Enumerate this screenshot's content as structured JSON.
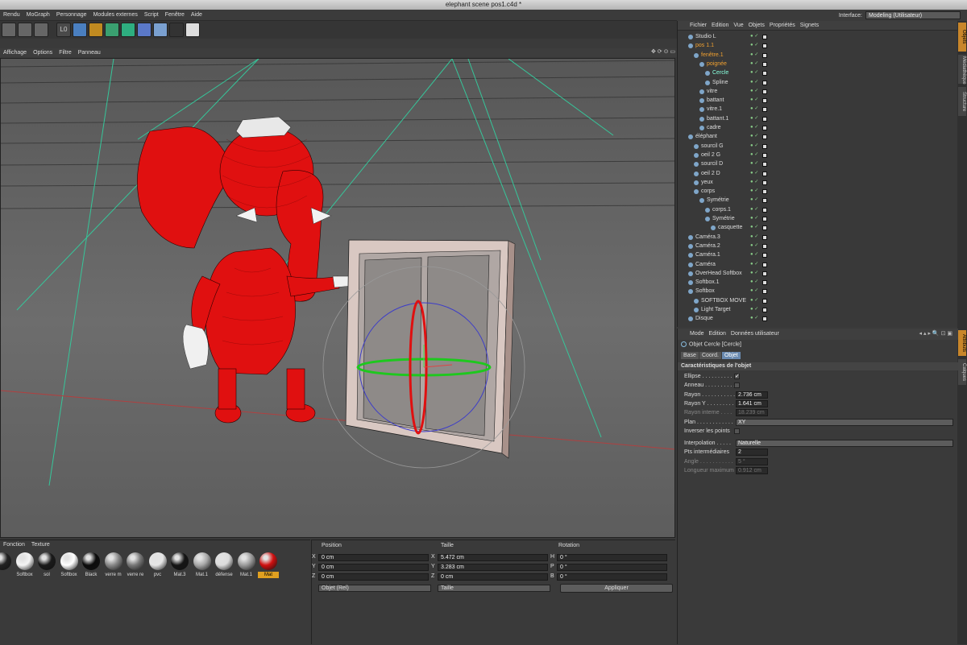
{
  "window": {
    "title": "elephant scene pos1.c4d *"
  },
  "menu": [
    "Rendu",
    "MoGraph",
    "Personnage",
    "Modules externes",
    "Script",
    "Fenêtre",
    "Aide"
  ],
  "interface": {
    "label": "Interface:",
    "value": "Modeling (Utilisateur)"
  },
  "viewport_menu": [
    "Affichage",
    "Options",
    "Filtre",
    "Panneau"
  ],
  "viewport_icons": "✥ ⟳ ⊙ ▭",
  "object_menu": [
    "Fichier",
    "Edition",
    "Vue",
    "Objets",
    "Propriétés",
    "Signets"
  ],
  "objects": [
    {
      "name": "Studio L",
      "indent": 1
    },
    {
      "name": "pos 1.1",
      "indent": 1,
      "hl": true
    },
    {
      "name": "fenêtre.1",
      "indent": 2,
      "hl": true
    },
    {
      "name": "poignée",
      "indent": 3,
      "hl": true
    },
    {
      "name": "Cercle",
      "indent": 4,
      "cyan": true
    },
    {
      "name": "Spline",
      "indent": 4
    },
    {
      "name": "vitre",
      "indent": 3
    },
    {
      "name": "battant",
      "indent": 3
    },
    {
      "name": "vitre.1",
      "indent": 3
    },
    {
      "name": "battant.1",
      "indent": 3
    },
    {
      "name": "cadre",
      "indent": 3
    },
    {
      "name": "éléphant",
      "indent": 1
    },
    {
      "name": "sourcil G",
      "indent": 2
    },
    {
      "name": "oeil 2 G",
      "indent": 2
    },
    {
      "name": "sourcil D",
      "indent": 2
    },
    {
      "name": "oeil 2 D",
      "indent": 2
    },
    {
      "name": "yeux",
      "indent": 2
    },
    {
      "name": "corps",
      "indent": 2
    },
    {
      "name": "Symétrie",
      "indent": 3
    },
    {
      "name": "corps.1",
      "indent": 4
    },
    {
      "name": "Symétrie",
      "indent": 4
    },
    {
      "name": "casquette",
      "indent": 5
    },
    {
      "name": "Caméra.3",
      "indent": 1
    },
    {
      "name": "Caméra.2",
      "indent": 1
    },
    {
      "name": "Caméra.1",
      "indent": 1
    },
    {
      "name": "Caméra",
      "indent": 1
    },
    {
      "name": "OverHead Softbox",
      "indent": 1
    },
    {
      "name": "Softbox.1",
      "indent": 1
    },
    {
      "name": "Softbox",
      "indent": 1
    },
    {
      "name": "SOFTBOX MOVE",
      "indent": 2
    },
    {
      "name": "Light Target",
      "indent": 2
    },
    {
      "name": "Disque",
      "indent": 1
    }
  ],
  "side_tabs_top": [
    "Objets",
    "Médiathèque",
    "Structure"
  ],
  "side_tabs_bottom": [
    "Attributs",
    "Calques"
  ],
  "attr": {
    "menu": [
      "Mode",
      "Edition",
      "Données utilisateur"
    ],
    "nav": "◂ ▴ ▸ 🔍 ⊡ ▣",
    "title": "Objet Cercle [Cercle]",
    "tabs": [
      "Base",
      "Coord.",
      "Objet"
    ],
    "section": "Caractéristiques de l'objet",
    "rows": [
      {
        "label": "Ellipse . . . . . . . . . .",
        "type": "check",
        "value": "✓"
      },
      {
        "label": "Anneau . . . . . . . . . .",
        "type": "check",
        "value": ""
      },
      {
        "label": "Rayon . . . . . . . . . . .",
        "type": "field",
        "value": "2.736 cm"
      },
      {
        "label": "Rayon Y . . . . . . . . .",
        "type": "field",
        "value": "1.641 cm"
      },
      {
        "label": "Rayon interne . . . .",
        "type": "field",
        "value": "18.239 cm",
        "dim": true
      },
      {
        "label": "Plan . . . . . . . . . . . .",
        "type": "dd",
        "value": "XY"
      },
      {
        "label": "Inverser les points",
        "type": "check",
        "value": ""
      },
      {
        "label": "Interpolation . . . . .",
        "type": "dd",
        "value": "Naturelle",
        "gap": true
      },
      {
        "label": "Pts intermédiaires",
        "type": "field",
        "value": "2"
      },
      {
        "label": "Angle . . . . . . . . . . .",
        "type": "field",
        "value": "5 °",
        "dim": true
      },
      {
        "label": "Longueur maximum",
        "type": "field",
        "value": "0.912 cm",
        "dim": true
      }
    ]
  },
  "materials_menu": [
    "Fonction",
    "Texture"
  ],
  "materials": [
    {
      "label": "",
      "color": "#222"
    },
    {
      "label": "Softbox",
      "color": "#f4f4f4"
    },
    {
      "label": "sol",
      "color": "#1a1a1a"
    },
    {
      "label": "Softbox",
      "color": "#ffffff"
    },
    {
      "label": "Black",
      "color": "#0c0c0c"
    },
    {
      "label": "verre m",
      "color": "#888"
    },
    {
      "label": "verre re",
      "color": "#777"
    },
    {
      "label": "pvc",
      "color": "#e6e6e6"
    },
    {
      "label": "Mat.3",
      "color": "#151515"
    },
    {
      "label": "Mat.1",
      "color": "#a8a8a8"
    },
    {
      "label": "défense",
      "color": "#dcdcdc"
    },
    {
      "label": "Mat.1",
      "color": "#9a9a9a"
    },
    {
      "label": "Mat",
      "color": "#d01010",
      "selected": true
    }
  ],
  "coords": {
    "headers": [
      "Position",
      "Taille",
      "Rotation"
    ],
    "axes1": [
      "X",
      "Y",
      "Z"
    ],
    "axes2": [
      "X",
      "Y",
      "Z"
    ],
    "axes3": [
      "H",
      "P",
      "B"
    ],
    "position": [
      "0 cm",
      "0 cm",
      "0 cm"
    ],
    "size": [
      "5.472 cm",
      "3.283 cm",
      "0 cm"
    ],
    "rotation": [
      "0 °",
      "0 °",
      "0 °"
    ],
    "mode1": "Objet (Rel)",
    "mode2": "Taille",
    "apply": "Appliquer"
  },
  "colors": {
    "accent": "#e0a020",
    "selection": "#6a8ab0",
    "model_red": "#e01010"
  }
}
